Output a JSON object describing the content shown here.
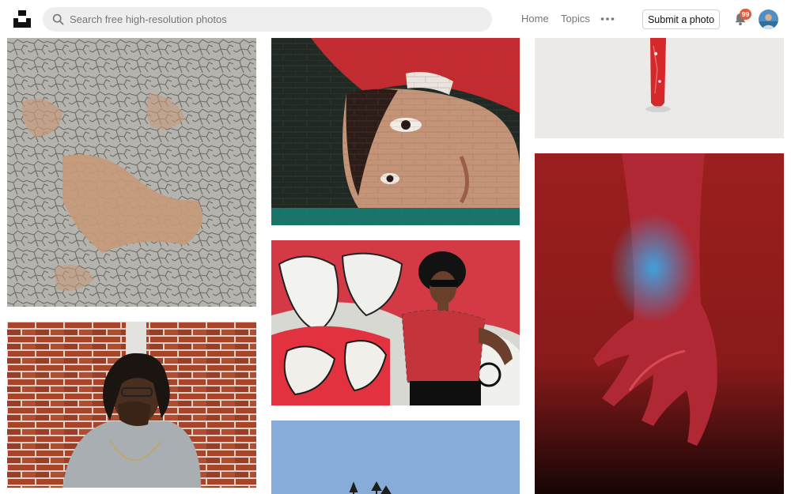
{
  "header": {
    "search": {
      "placeholder": "Search free high-resolution photos",
      "value": ""
    },
    "nav": {
      "home": "Home",
      "topics": "Topics"
    },
    "submit_label": "Submit a photo",
    "notifications_count": "99"
  },
  "colors": {
    "badge": "#e25c3d",
    "search_bg": "#eeeeee",
    "nav_text": "#767676"
  },
  "icons": [
    "unsplash-logo-icon",
    "search-icon",
    "more-dots-icon",
    "bell-icon",
    "avatar"
  ],
  "photos": [
    {
      "subject": "peeling grey paint texture"
    },
    {
      "subject": "man in grey sweatshirt against red brick wall"
    },
    {
      "subject": "mural of woman's face on brick wall"
    },
    {
      "subject": "woman in plaid top and sunglasses before graffiti"
    },
    {
      "subject": "blue sky with treetops"
    },
    {
      "subject": "red object on white background"
    },
    {
      "subject": "hand with red and blue light"
    }
  ]
}
